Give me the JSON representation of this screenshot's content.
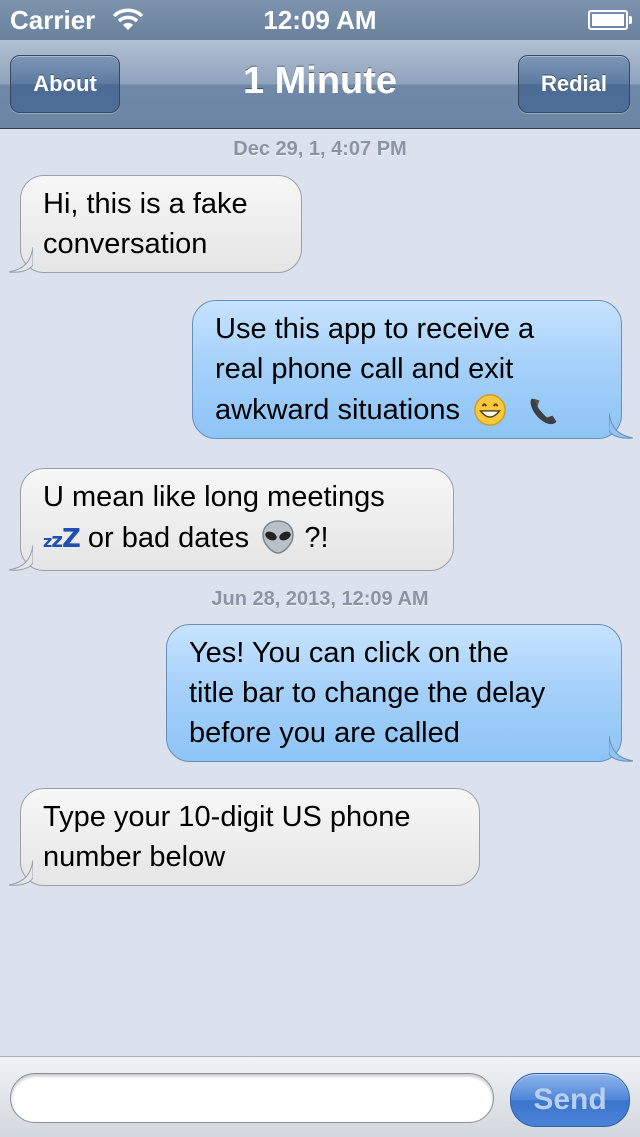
{
  "status_bar": {
    "carrier": "Carrier",
    "time": "12:09 AM"
  },
  "nav": {
    "title": "1 Minute",
    "left_button": "About",
    "right_button": "Redial"
  },
  "conversation": [
    {
      "type": "timestamp",
      "text": "Dec 29, 1, 4:07 PM"
    },
    {
      "type": "incoming",
      "lines": [
        "Hi, this is a fake",
        "conversation"
      ]
    },
    {
      "type": "outgoing",
      "lines": [
        "Use this app to receive a",
        "real phone call and exit",
        "awkward situations"
      ],
      "emoji": [
        "grinning-face",
        "telephone-receiver"
      ]
    },
    {
      "type": "incoming",
      "lines": [
        "U mean like long meetings",
        "or bad dates"
      ],
      "line2_prefix": "zzZ",
      "line2_suffix": "?!",
      "emoji": [
        "sleeping-zzz",
        "alien-face"
      ]
    },
    {
      "type": "timestamp",
      "text": "Jun 28, 2013, 12:09 AM"
    },
    {
      "type": "outgoing",
      "lines": [
        "Yes!  You can click on the",
        "title bar to change the delay",
        "before you are called"
      ]
    },
    {
      "type": "incoming",
      "lines": [
        "Type your 10-digit US phone",
        "number below"
      ]
    }
  ],
  "composer": {
    "input_value": "",
    "send_label": "Send"
  },
  "colors": {
    "incoming_bubble": "#e8e8e8",
    "outgoing_bubble": "#a6d1fa",
    "background": "#dbe2ed",
    "nav_bar": "#7a90ad"
  }
}
